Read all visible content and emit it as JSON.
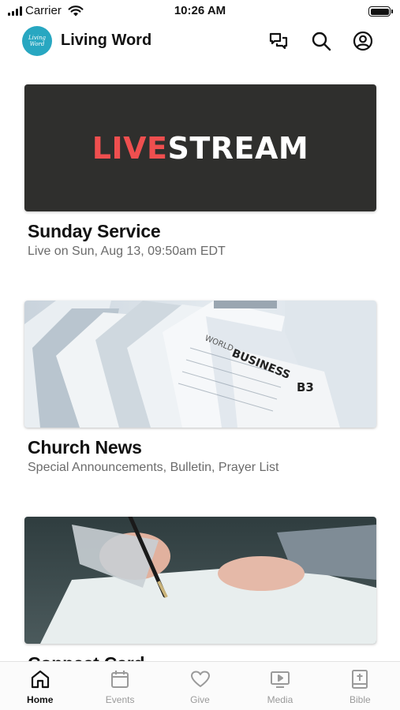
{
  "status_bar": {
    "carrier": "Carrier",
    "time": "10:26 AM"
  },
  "header": {
    "app_name": "Living Word",
    "logo_text_line1": "Living",
    "logo_text_line2": "Word",
    "icons": [
      "chat-icon",
      "search-icon",
      "profile-icon"
    ]
  },
  "cards": [
    {
      "image_text_accent": "LIVE",
      "image_text_main": "STREAM",
      "title": "Sunday Service",
      "subtitle": "Live on Sun, Aug 13, 09:50am EDT"
    },
    {
      "image_text_1": "WORLD",
      "image_text_2": "BUSINESS",
      "image_text_3": "B3",
      "title": "Church News",
      "subtitle": "Special Announcements, Bulletin, Prayer List"
    },
    {
      "title": "Connect Card",
      "subtitle": ""
    }
  ],
  "tabs": [
    {
      "label": "Home",
      "icon": "home-icon",
      "active": true
    },
    {
      "label": "Events",
      "icon": "calendar-icon",
      "active": false
    },
    {
      "label": "Give",
      "icon": "heart-icon",
      "active": false
    },
    {
      "label": "Media",
      "icon": "media-icon",
      "active": false
    },
    {
      "label": "Bible",
      "icon": "bible-icon",
      "active": false
    }
  ],
  "colors": {
    "brand": "#28a7c1",
    "livestream_accent": "#ef4f4f",
    "livestream_bg": "#2f2f2d",
    "tab_active": "#111111",
    "tab_inactive": "#9a9a9a"
  }
}
